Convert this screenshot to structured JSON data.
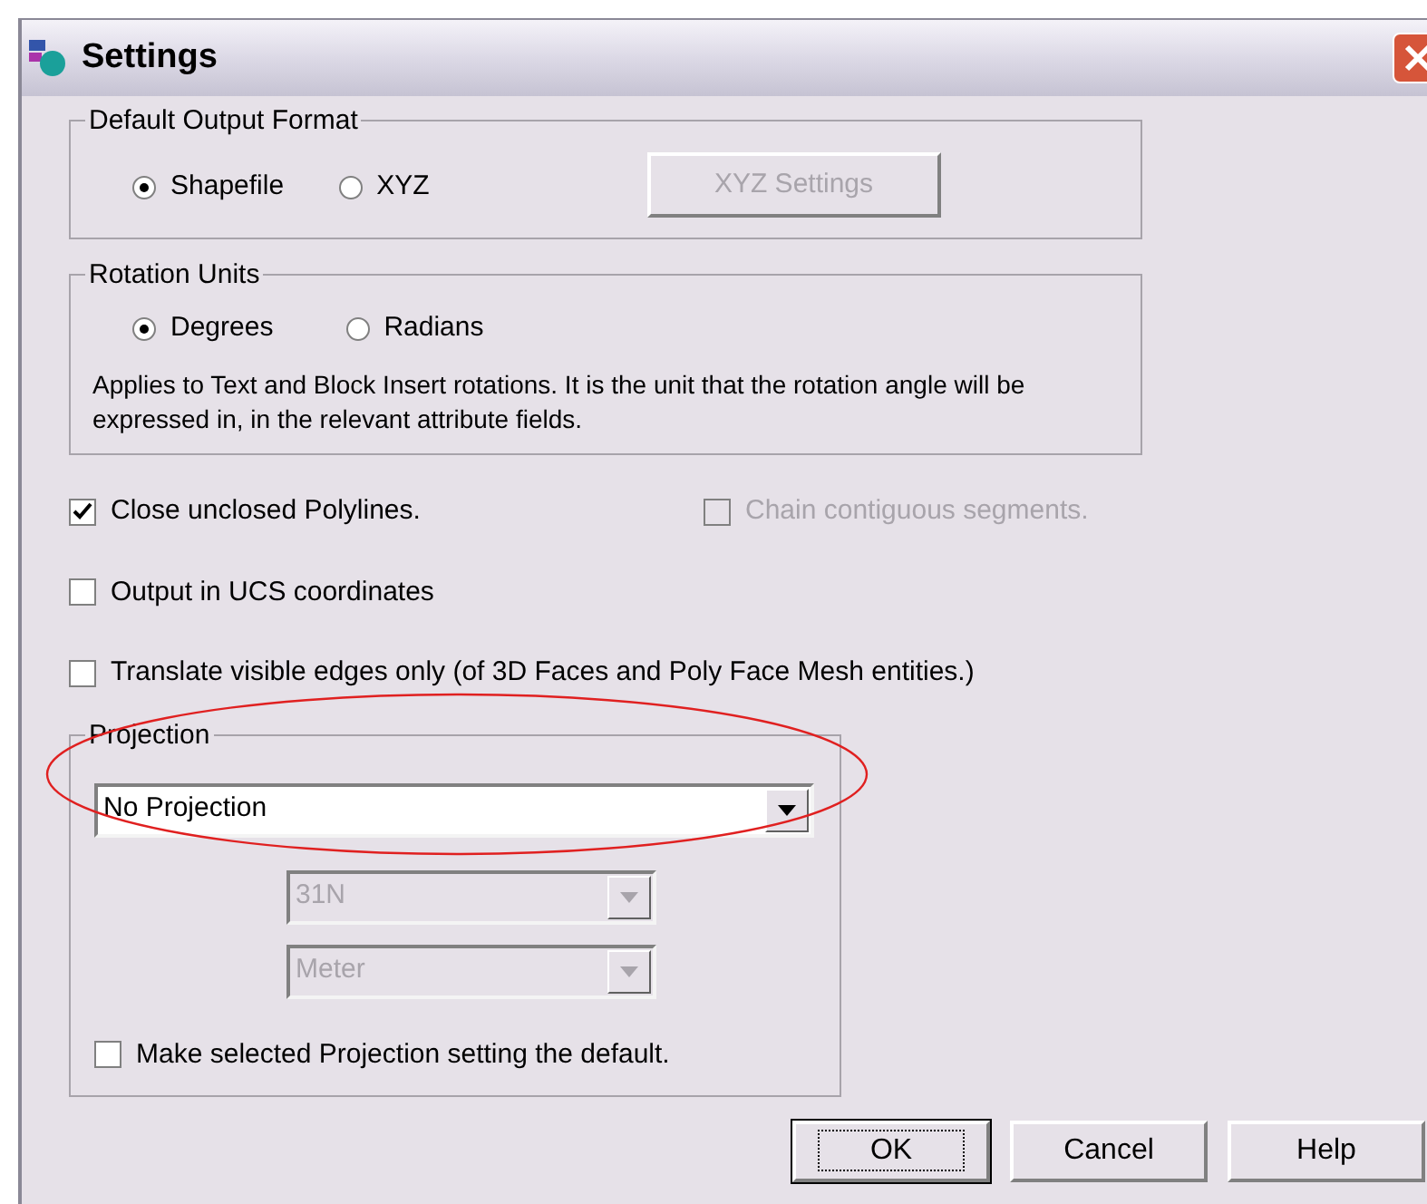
{
  "window": {
    "title": "Settings"
  },
  "output_format": {
    "title": "Default Output Format",
    "options": [
      {
        "label": "Shapefile",
        "selected": true
      },
      {
        "label": "XYZ",
        "selected": false
      }
    ],
    "settings_button": {
      "label": "XYZ Settings",
      "disabled": true
    }
  },
  "rotation_units": {
    "title": "Rotation Units",
    "options": [
      {
        "label": "Degrees",
        "selected": true
      },
      {
        "label": "Radians",
        "selected": false
      }
    ],
    "note": "Applies to Text and Block Insert rotations.  It is the unit that the rotation angle will be expressed in, in the relevant attribute fields."
  },
  "options": [
    {
      "label": "Close unclosed Polylines.",
      "checked": true,
      "disabled": false
    },
    {
      "label": "Chain contiguous segments.",
      "checked": false,
      "disabled": true
    },
    {
      "label": "Output in UCS coordinates",
      "checked": false,
      "disabled": false
    },
    {
      "label": "Translate visible edges only (of 3D Faces and Poly Face Mesh entities.)",
      "checked": false,
      "disabled": false
    }
  ],
  "projection": {
    "title": "Projection",
    "value": "No Projection",
    "zone": {
      "value": "31N",
      "disabled": true
    },
    "unit": {
      "value": "Meter",
      "disabled": true
    },
    "default_option": {
      "label": "Make selected Projection setting the default.",
      "checked": false
    }
  },
  "buttons": [
    {
      "label": "OK",
      "default": true
    },
    {
      "label": "Cancel",
      "default": false
    },
    {
      "label": "Help",
      "default": false
    }
  ]
}
